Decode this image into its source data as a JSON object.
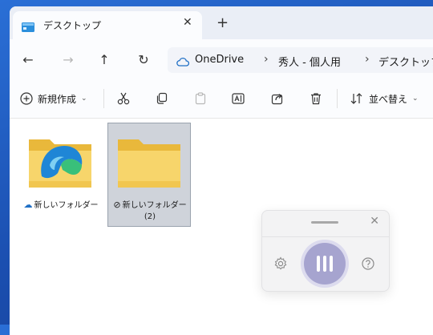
{
  "tab": {
    "title": "デスクトップ",
    "close_glyph": "✕",
    "new_glyph": "+"
  },
  "nav": {
    "back": "←",
    "forward": "→",
    "up": "↑",
    "refresh": "↻"
  },
  "breadcrumb": {
    "root": "OneDrive",
    "items": [
      "秀人 - 個人用",
      "デスクトップ"
    ],
    "separator": "›"
  },
  "toolbar": {
    "new_label": "新規作成",
    "sort_label": "並べ替え",
    "caret": "⌄",
    "icons": [
      "plus-circle-icon",
      "cut-icon",
      "copy-icon",
      "paste-icon",
      "rename-icon",
      "share-icon",
      "delete-icon",
      "sort-icon"
    ]
  },
  "items": [
    {
      "label": "新しいフォルダー",
      "status": "☁",
      "status_name": "cloud-status-icon",
      "selected": false
    },
    {
      "label": "新しいフォルダー",
      "sub": "(2)",
      "status": "⊘",
      "status_name": "synced-status-icon",
      "selected": true
    }
  ],
  "voice_panel": {
    "close_glyph": "✕",
    "icons": [
      "gear-icon",
      "mic-icon",
      "help-icon"
    ]
  },
  "colors": {
    "desktop": "#1b4fb0",
    "folder": "#f7d56b",
    "folder_dark": "#e9b83b",
    "edge_blue": "#1f86d6",
    "edge_green": "#39c07a",
    "mic": "#a6a4cf",
    "selection": "#cfd3da"
  }
}
